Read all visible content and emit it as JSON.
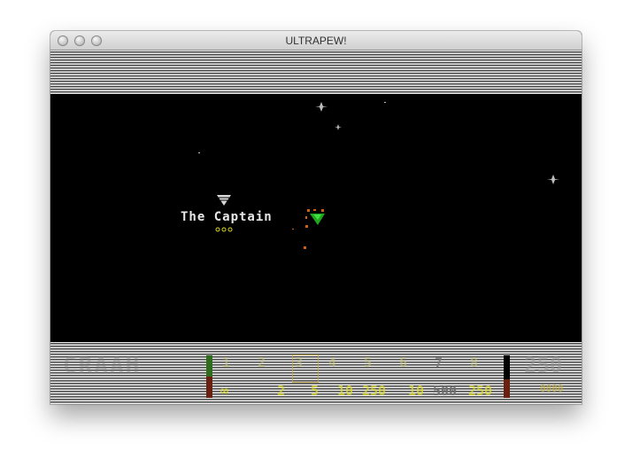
{
  "window": {
    "title": "ULTRAPEW!"
  },
  "player": {
    "name": "The Captain"
  },
  "hud": {
    "ghost_score": "CRAAH",
    "weapon_slots": [
      {
        "number": "1",
        "count": "∞"
      },
      {
        "number": "2",
        "count": "2"
      },
      {
        "number": "3",
        "count": "5",
        "selected": true
      },
      {
        "number": "4",
        "count": "10"
      },
      {
        "number": "5",
        "count": "250"
      },
      {
        "number": "6",
        "count": "10"
      },
      {
        "number": "7",
        "count": "500"
      },
      {
        "number": "8",
        "count": "250"
      }
    ],
    "score": "250",
    "sub_score": "0000",
    "health_level": 0.5,
    "energy_level": 0.44
  },
  "colors": {
    "player_ship": "#1fa81f",
    "marker": "#d8d8d8",
    "debris": "#d06010",
    "hud_yellow": "#dcdc28"
  }
}
